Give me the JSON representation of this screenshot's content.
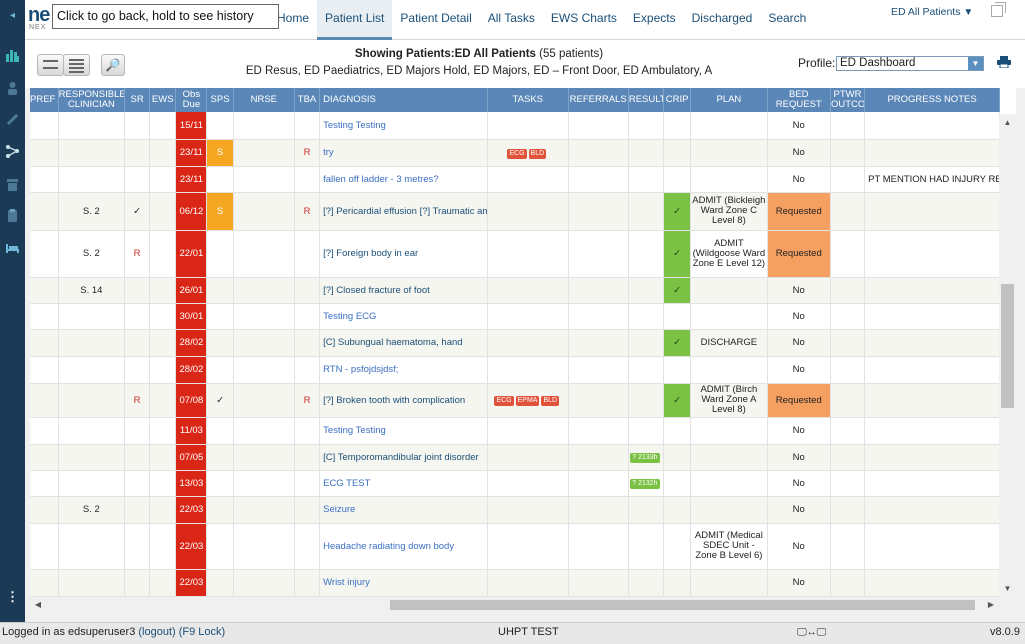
{
  "app": {
    "logo": "ne",
    "logo_sub": "NEX",
    "back_tooltip": "Click to go back, hold to see history"
  },
  "nav": {
    "items": [
      {
        "label": "Home"
      },
      {
        "label": "Patient List"
      },
      {
        "label": "Patient Detail"
      },
      {
        "label": "All Tasks"
      },
      {
        "label": "EWS Charts"
      },
      {
        "label": "Expects"
      },
      {
        "label": "Discharged"
      },
      {
        "label": "Search"
      }
    ],
    "active": "Patient List",
    "location": "ED All Patients",
    "location_chevron": "▼"
  },
  "header": {
    "showing_label": "Showing Patients:",
    "showing_list": "ED All Patients",
    "showing_count": "(55 patients)",
    "units": "ED Resus, ED Paediatrics, ED Majors Hold, ED Majors, ED – Front Door, ED Ambulatory, A",
    "profile_label": "Profile:",
    "profile_value": "ED Dashboard"
  },
  "columns": [
    "PREF AREA",
    "RESPONSIBLE CLINICIAN",
    "SR",
    "EWS",
    "Obs Due",
    "SPS",
    "NRSE",
    "TBA",
    "DIAGNOSIS",
    "TASKS",
    "REFERRALS",
    "RESULT",
    "CRIP",
    "PLAN",
    "BED REQUEST",
    "PTWR OUTCO",
    "PROGRESS NOTES"
  ],
  "rows": [
    {
      "clin": "",
      "sr": "",
      "obs": "15/11",
      "sps": "",
      "tba": "",
      "dx": "Testing Testing",
      "dx_link": true,
      "tasks": [],
      "results": [],
      "crip": "",
      "plan": "",
      "bed": "No",
      "notes": ""
    },
    {
      "clin": "",
      "sr": "",
      "obs": "23/11",
      "sps": "S",
      "tba": "R",
      "dx": "try",
      "dx_link": true,
      "tasks": [
        "ECG",
        "BLD"
      ],
      "results": [],
      "crip": "",
      "plan": "",
      "bed": "No",
      "notes": ""
    },
    {
      "clin": "",
      "sr": "",
      "obs": "23/11",
      "sps": "",
      "tba": "",
      "dx": "fallen off ladder - 3 metres?",
      "dx_link": true,
      "tasks": [],
      "results": [],
      "crip": "",
      "plan": "",
      "bed": "No",
      "notes": "PT MENTION HAD INJURY REF"
    },
    {
      "clin": "S. 2",
      "sr": "✓",
      "obs": "06/12",
      "sps": "S",
      "tba": "R",
      "dx": "[?] Pericardial effusion [?] Traumatic amp",
      "dx_link": false,
      "tasks": [],
      "results": [],
      "crip": "✓",
      "plan": "ADMIT (Bickleigh Ward Zone C Level 8)",
      "bed": "Requested",
      "notes": ""
    },
    {
      "clin": "S. 2",
      "sr": "R",
      "obs": "22/01",
      "sps": "",
      "tba": "",
      "dx": "[?] Foreign body in ear",
      "dx_link": false,
      "tasks": [],
      "results": [],
      "crip": "✓",
      "plan": "ADMIT (Wildgoose Ward Zone E Level 12)",
      "bed": "Requested",
      "notes": ""
    },
    {
      "clin": "S. 14",
      "sr": "",
      "obs": "26/01",
      "sps": "",
      "tba": "",
      "dx": "[?] Closed fracture of foot",
      "dx_link": false,
      "tasks": [],
      "results": [],
      "crip": "✓",
      "plan": "",
      "bed": "No",
      "notes": ""
    },
    {
      "clin": "",
      "sr": "",
      "obs": "30/01",
      "sps": "",
      "tba": "",
      "dx": "Testing ECG",
      "dx_link": true,
      "tasks": [],
      "results": [],
      "crip": "",
      "plan": "",
      "bed": "No",
      "notes": ""
    },
    {
      "clin": "",
      "sr": "",
      "obs": "28/02",
      "sps": "",
      "tba": "",
      "dx": "[C] Subungual haematoma, hand",
      "dx_link": false,
      "tasks": [],
      "results": [],
      "crip": "✓",
      "plan": "DISCHARGE",
      "bed": "No",
      "notes": ""
    },
    {
      "clin": "",
      "sr": "",
      "obs": "28/02",
      "sps": "",
      "tba": "",
      "dx": "RTN - psfojdsjdsf;",
      "dx_link": true,
      "tasks": [],
      "results": [],
      "crip": "",
      "plan": "",
      "bed": "No",
      "notes": ""
    },
    {
      "clin": "",
      "sr": "R",
      "obs": "07/08",
      "sps": "✓",
      "tba": "R",
      "dx": "[?] Broken tooth with complication",
      "dx_link": false,
      "tasks": [
        "ECG",
        "EPMA",
        "BLD"
      ],
      "results": [],
      "crip": "✓",
      "plan": "ADMIT (Birch Ward Zone A Level 8)",
      "bed": "Requested",
      "notes": ""
    },
    {
      "clin": "",
      "sr": "",
      "obs": "11/03",
      "sps": "",
      "tba": "",
      "dx": "Testing Testing",
      "dx_link": true,
      "tasks": [],
      "results": [],
      "crip": "",
      "plan": "",
      "bed": "No",
      "notes": ""
    },
    {
      "clin": "",
      "sr": "",
      "obs": "07/05",
      "sps": "",
      "tba": "",
      "dx": "[C] Temporomandibular joint disorder",
      "dx_link": false,
      "tasks": [],
      "results": [
        "? 2133h"
      ],
      "crip": "",
      "plan": "",
      "bed": "No",
      "notes": ""
    },
    {
      "clin": "",
      "sr": "",
      "obs": "13/03",
      "sps": "",
      "tba": "",
      "dx": "ECG TEST",
      "dx_link": true,
      "tasks": [],
      "results": [
        "? 2132h"
      ],
      "crip": "",
      "plan": "",
      "bed": "No",
      "notes": ""
    },
    {
      "clin": "S. 2",
      "sr": "",
      "obs": "22/03",
      "sps": "",
      "tba": "",
      "dx": "Seizure",
      "dx_link": true,
      "tasks": [],
      "results": [],
      "crip": "",
      "plan": "",
      "bed": "No",
      "notes": ""
    },
    {
      "clin": "",
      "sr": "",
      "obs": "22/03",
      "sps": "",
      "tba": "",
      "dx": "Headache radiating down body",
      "dx_link": true,
      "tasks": [],
      "results": [],
      "crip": "",
      "plan": "ADMIT (Medical SDEC Unit - Zone B Level 6)",
      "bed": "No",
      "notes": ""
    },
    {
      "clin": "",
      "sr": "",
      "obs": "22/03",
      "sps": "",
      "tba": "",
      "dx": "Wrist injury",
      "dx_link": true,
      "tasks": [],
      "results": [],
      "crip": "",
      "plan": "",
      "bed": "No",
      "notes": ""
    }
  ],
  "status": {
    "logged_in": "Logged in as edsuperuser3",
    "logout": "(logout)",
    "lock": "(F9 Lock)",
    "environment": "UHPT TEST",
    "connection": "🖵↔🖵",
    "version": "v8.0.9"
  },
  "colors": {
    "nav_blue": "#1b4f78",
    "header_blue": "#5b87b8",
    "obs_red": "#d92616",
    "sps_orange": "#f5a623",
    "crip_green": "#7bc143",
    "bed_requested": "#f5a061"
  }
}
